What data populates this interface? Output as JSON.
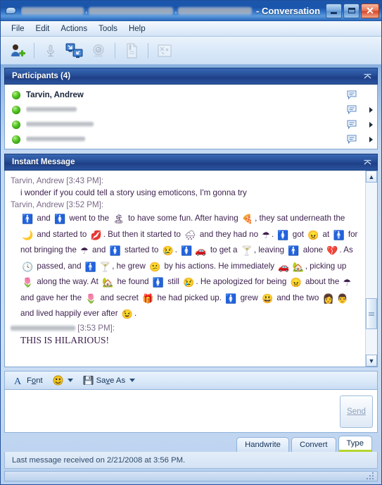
{
  "window": {
    "title_suffix": "- Conversation",
    "app_icon": "chat-bubble-icon",
    "buttons": {
      "minimize": "minimize-icon",
      "maximize": "maximize-icon",
      "close": "close-icon"
    }
  },
  "menubar": {
    "items": [
      {
        "label": "File"
      },
      {
        "label": "Edit"
      },
      {
        "label": "Actions"
      },
      {
        "label": "Tools"
      },
      {
        "label": "Help"
      }
    ]
  },
  "toolbar": {
    "buttons": [
      {
        "name": "invite-person-icon",
        "enabled": true
      },
      {
        "name": "microphone-icon",
        "enabled": false
      },
      {
        "name": "share-desktop-icon",
        "enabled": true
      },
      {
        "name": "webcam-icon",
        "enabled": false
      },
      {
        "name": "send-file-icon",
        "enabled": false
      },
      {
        "name": "whiteboard-icon",
        "enabled": false
      }
    ]
  },
  "participants": {
    "header": "Participants (4)",
    "collapse_icon": "collapse-chevron-icon",
    "rows": [
      {
        "name": "Tarvin, Andrew",
        "redacted": false,
        "status": "online",
        "chat_icon": "chat-bubble-icon",
        "has_arrow": false
      },
      {
        "name": "",
        "redacted": true,
        "status": "online",
        "chat_icon": "chat-bubble-icon",
        "has_arrow": true
      },
      {
        "name": "",
        "redacted": true,
        "status": "online",
        "chat_icon": "chat-bubble-icon",
        "has_arrow": true
      },
      {
        "name": "",
        "redacted": true,
        "status": "online",
        "chat_icon": "chat-bubble-icon",
        "has_arrow": true
      }
    ]
  },
  "instant_message": {
    "header": "Instant Message",
    "collapse_icon": "collapse-chevron-icon",
    "messages": [
      {
        "sender_line": "Tarvin, Andrew [3:43 PM]:",
        "text": "i wonder if you could tell a story using emoticons, I'm gonna try"
      },
      {
        "sender_line": "Tarvin, Andrew [3:52 PM]:",
        "story_parts": [
          {
            "type": "emoji",
            "name": "boy-icon",
            "glyph": "🚹"
          },
          {
            "type": "text",
            "value": " and "
          },
          {
            "type": "emoji",
            "name": "girl-icon",
            "glyph": "🚺"
          },
          {
            "type": "text",
            "value": " went to the "
          },
          {
            "type": "emoji",
            "name": "island-icon",
            "glyph": "🏝"
          },
          {
            "type": "text",
            "value": " to have some fun.  After having "
          },
          {
            "type": "emoji",
            "name": "pizza-icon",
            "glyph": "🍕"
          },
          {
            "type": "text",
            "value": ", they sat underneath the "
          },
          {
            "type": "emoji",
            "name": "moon-icon",
            "glyph": "🌙"
          },
          {
            "type": "text",
            "value": " and started to "
          },
          {
            "type": "emoji",
            "name": "kiss-lips-icon",
            "glyph": "💋"
          },
          {
            "type": "text",
            "value": ".  But then it started to "
          },
          {
            "type": "emoji",
            "name": "rain-cloud-icon",
            "glyph": "🌧"
          },
          {
            "type": "text",
            "value": " and they had no "
          },
          {
            "type": "emoji",
            "name": "umbrella-icon",
            "glyph": "☂"
          },
          {
            "type": "text",
            "value": ".  "
          },
          {
            "type": "emoji",
            "name": "girl-icon",
            "glyph": "🚺"
          },
          {
            "type": "text",
            "value": " got "
          },
          {
            "type": "emoji",
            "name": "angry-face-icon",
            "glyph": "😠"
          },
          {
            "type": "text",
            "value": " at "
          },
          {
            "type": "emoji",
            "name": "boy-icon",
            "glyph": "🚹"
          },
          {
            "type": "text",
            "value": " for not bringing the "
          },
          {
            "type": "emoji",
            "name": "umbrella-icon",
            "glyph": "☂"
          },
          {
            "type": "text",
            "value": " and "
          },
          {
            "type": "emoji",
            "name": "girl-icon",
            "glyph": "🚺"
          },
          {
            "type": "text",
            "value": " started to "
          },
          {
            "type": "emoji",
            "name": "crying-face-icon",
            "glyph": "😢"
          },
          {
            "type": "text",
            "value": ".  "
          },
          {
            "type": "emoji",
            "name": "girl-icon",
            "glyph": "🚺"
          },
          {
            "type": "emoji",
            "name": "car-icon",
            "glyph": "🚗"
          },
          {
            "type": "text",
            "value": " to get a "
          },
          {
            "type": "emoji",
            "name": "cocktail-icon",
            "glyph": "🍸"
          },
          {
            "type": "text",
            "value": ", leaving "
          },
          {
            "type": "emoji",
            "name": "boy-icon",
            "glyph": "🚹"
          },
          {
            "type": "text",
            "value": " alone "
          },
          {
            "type": "emoji",
            "name": "broken-heart-icon",
            "glyph": "💔"
          },
          {
            "type": "text",
            "value": ".  As "
          },
          {
            "type": "emoji",
            "name": "clock-icon",
            "glyph": "🕓"
          },
          {
            "type": "text",
            "value": " passed, and "
          },
          {
            "type": "emoji",
            "name": "boy-icon",
            "glyph": "🚹"
          },
          {
            "type": "emoji",
            "name": "cocktail-icon",
            "glyph": "🍸"
          },
          {
            "type": "text",
            "value": ", he grew "
          },
          {
            "type": "emoji",
            "name": "sad-face-icon",
            "glyph": "😕"
          },
          {
            "type": "text",
            "value": " by his actions.  He immediately "
          },
          {
            "type": "emoji",
            "name": "car-icon",
            "glyph": "🚗"
          },
          {
            "type": "emoji",
            "name": "house-icon",
            "glyph": "🏡"
          },
          {
            "type": "text",
            "value": ", picking up "
          },
          {
            "type": "emoji",
            "name": "flower-icon",
            "glyph": "🌷"
          },
          {
            "type": "text",
            "value": " along the way.  At "
          },
          {
            "type": "emoji",
            "name": "house-icon",
            "glyph": "🏡"
          },
          {
            "type": "text",
            "value": " he found "
          },
          {
            "type": "emoji",
            "name": "girl-icon",
            "glyph": "🚺"
          },
          {
            "type": "text",
            "value": " still "
          },
          {
            "type": "emoji",
            "name": "crying-face-icon",
            "glyph": "😢"
          },
          {
            "type": "text",
            "value": ".  He apologized for being "
          },
          {
            "type": "emoji",
            "name": "angry-face-icon",
            "glyph": "😠"
          },
          {
            "type": "text",
            "value": " about the "
          },
          {
            "type": "emoji",
            "name": "umbrella-icon",
            "glyph": "☂"
          },
          {
            "type": "text",
            "value": " and gave her the "
          },
          {
            "type": "emoji",
            "name": "flower-icon",
            "glyph": "🌷"
          },
          {
            "type": "text",
            "value": " and secret "
          },
          {
            "type": "emoji",
            "name": "gift-icon",
            "glyph": "🎁"
          },
          {
            "type": "text",
            "value": " he had picked up.  "
          },
          {
            "type": "emoji",
            "name": "girl-icon",
            "glyph": "🚺"
          },
          {
            "type": "text",
            "value": " grew "
          },
          {
            "type": "emoji",
            "name": "big-smile-icon",
            "glyph": "😃"
          },
          {
            "type": "text",
            "value": " and the two "
          },
          {
            "type": "emoji",
            "name": "person-serving-icon",
            "glyph": "👩"
          },
          {
            "type": "emoji",
            "name": "person-sitting-icon",
            "glyph": "👨"
          },
          {
            "type": "text",
            "value": " and lived happily ever after "
          },
          {
            "type": "emoji",
            "name": "wink-face-icon",
            "glyph": "😉"
          },
          {
            "type": "text",
            "value": "."
          }
        ]
      },
      {
        "sender_line_redacted": true,
        "sender_time": "[3:53 PM]:",
        "text": "THIS IS HILARIOUS!"
      }
    ],
    "scrollbar": {
      "up_icon": "scroll-up-icon",
      "down_icon": "scroll-down-icon",
      "thumb": "scroll-thumb"
    }
  },
  "compose": {
    "format_bar": [
      {
        "name": "font-button",
        "label": "Font",
        "icon": "font-A-icon",
        "has_caret": false
      },
      {
        "name": "emoticon-button",
        "label": "",
        "icon": "smiley-icon",
        "has_caret": true
      },
      {
        "name": "save-as-button",
        "label": "Save As",
        "icon": "floppy-disk-icon",
        "has_caret": true
      }
    ],
    "input_value": "",
    "input_placeholder": "",
    "send_label": "Send"
  },
  "tabs": [
    {
      "label": "Handwrite",
      "active": false
    },
    {
      "label": "Convert",
      "active": false
    },
    {
      "label": "Type",
      "active": true
    }
  ],
  "statusbar": {
    "text": "Last message received on 2/21/2008 at 3:56 PM.",
    "grip": "resize-grip-icon"
  },
  "colors": {
    "titlebar_blue": "#1b57ad",
    "panel_header_blue": "#27509a",
    "window_chrome": "#cfe0f4",
    "active_tab_underline": "#b6d430",
    "status_online_green": "#4fc21d",
    "close_button_red": "#d9482a"
  }
}
